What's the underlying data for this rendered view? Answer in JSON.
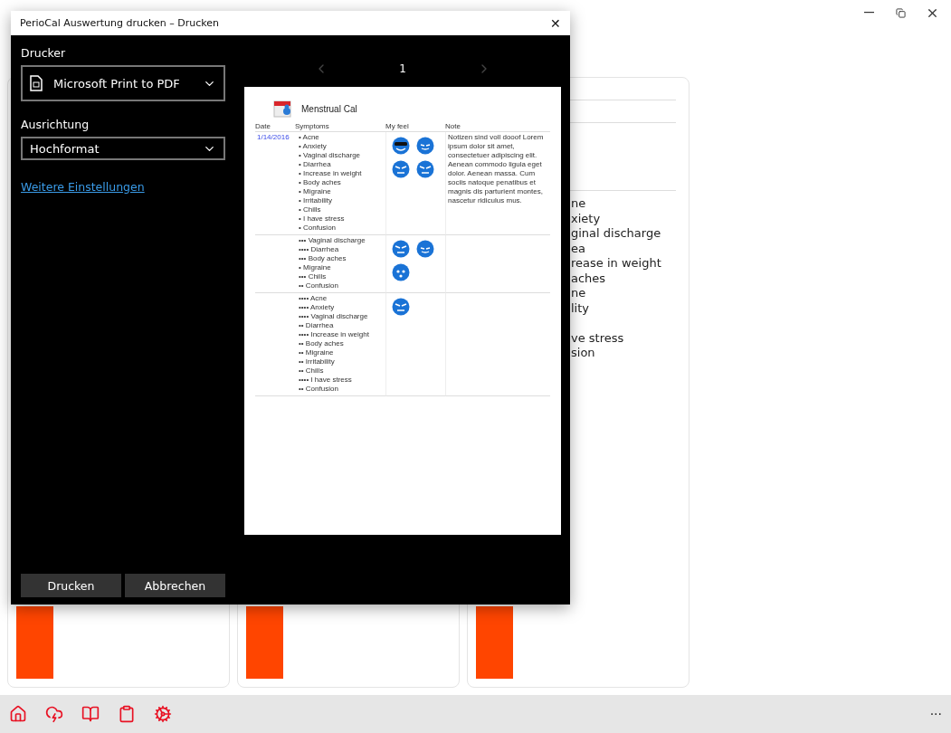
{
  "dialog": {
    "title": "PerioCal Auswertung drucken – Drucken",
    "close": "✕",
    "printer": {
      "label": "Drucker",
      "value": "Microsoft Print to PDF"
    },
    "orientation": {
      "label": "Ausrichtung",
      "value": "Hochformat"
    },
    "more_link": "Weitere Einstellungen",
    "buttons": [
      "Drucken",
      "Abbrechen"
    ],
    "page_number": "1",
    "preview": {
      "title": "Menstrual Cal",
      "columns": [
        "Date",
        "Symptoms",
        "My feel",
        "Note"
      ],
      "rows": [
        {
          "date": "1/14/2016",
          "symptoms": [
            "• Acne",
            "• Anxiety",
            "• Vaginal discharge",
            "• Diarrhea",
            "• Increase in weight",
            "• Body aches",
            "• Migraine",
            "• Irritability",
            "• Chills",
            "• I have stress",
            "• Confusion"
          ],
          "feels": [
            {
              "kind": "sunglasses"
            },
            {
              "kind": "grin"
            },
            {
              "kind": "angry"
            },
            {
              "kind": "angry"
            }
          ],
          "note": "Notizen sind voll dooof Lorem ipsum dolor sit amet, consectetuer adipiscing elit. Aenean commodo ligula eget dolor. Aenean massa. Cum sociis natoque penatibus et magnis dis parturient montes, nascetur ridiculus mus."
        },
        {
          "symptoms": [
            "••• Vaginal discharge",
            "•••• Diarrhea",
            "••• Body aches",
            "• Migraine",
            "••• Chills",
            "•• Confusion"
          ],
          "feels": [
            {
              "kind": "angry"
            },
            {
              "kind": "grin"
            },
            {
              "kind": "surprised"
            }
          ]
        },
        {
          "symptoms": [
            "•••• Acne",
            "•••• Anxiety",
            "•••• Vaginal discharge",
            "•• Diarrhea",
            "•••• Increase in weight",
            "•• Body aches",
            "•• Migraine",
            "•• Irritability",
            "•• Chills",
            "•••• I have stress",
            "•• Confusion"
          ],
          "feels": [
            {
              "kind": "angry"
            }
          ]
        }
      ]
    }
  },
  "background_card": {
    "items": [
      {
        "text": "ne",
        "gap_before": false
      },
      {
        "text": "xiety",
        "gap_before": false
      },
      {
        "text": "ginal discharge",
        "gap_before": false
      },
      {
        "text": "ea",
        "gap_before": false
      },
      {
        "text": "rease in weight",
        "gap_before": false
      },
      {
        "text": "aches",
        "gap_before": false
      },
      {
        "text": "ne",
        "gap_before": false
      },
      {
        "text": "lity",
        "gap_before": false
      },
      {
        "text": "ve stress",
        "gap_before": true
      },
      {
        "text": "sion",
        "gap_before": false
      }
    ]
  },
  "app_bar": {
    "more": "···"
  }
}
